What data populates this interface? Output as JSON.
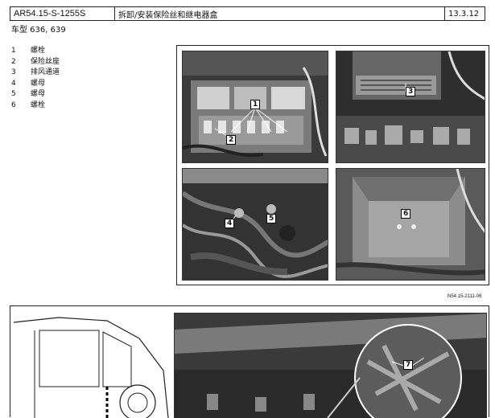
{
  "header": {
    "code": "AR54.15-S-1255S",
    "title": "拆卸/安装保险丝和继电器盒",
    "date": "13.3.12"
  },
  "model": "车型  636, 639",
  "legend": [
    {
      "num": "1",
      "label": "螺栓"
    },
    {
      "num": "2",
      "label": "保险丝座"
    },
    {
      "num": "3",
      "label": "排风通道"
    },
    {
      "num": "4",
      "label": "螺母"
    },
    {
      "num": "5",
      "label": "螺母"
    },
    {
      "num": "6",
      "label": "螺栓"
    }
  ],
  "figure1": {
    "callouts": [
      "1",
      "2",
      "3",
      "4",
      "5",
      "6"
    ],
    "ref": "N54.15-2111-06"
  },
  "figure2": {
    "callouts": [
      "7"
    ]
  },
  "colors": {
    "photo_dark": "#2b2b2b",
    "photo_mid": "#6b6b6b",
    "photo_light": "#bdbdbd",
    "border": "#222222"
  }
}
